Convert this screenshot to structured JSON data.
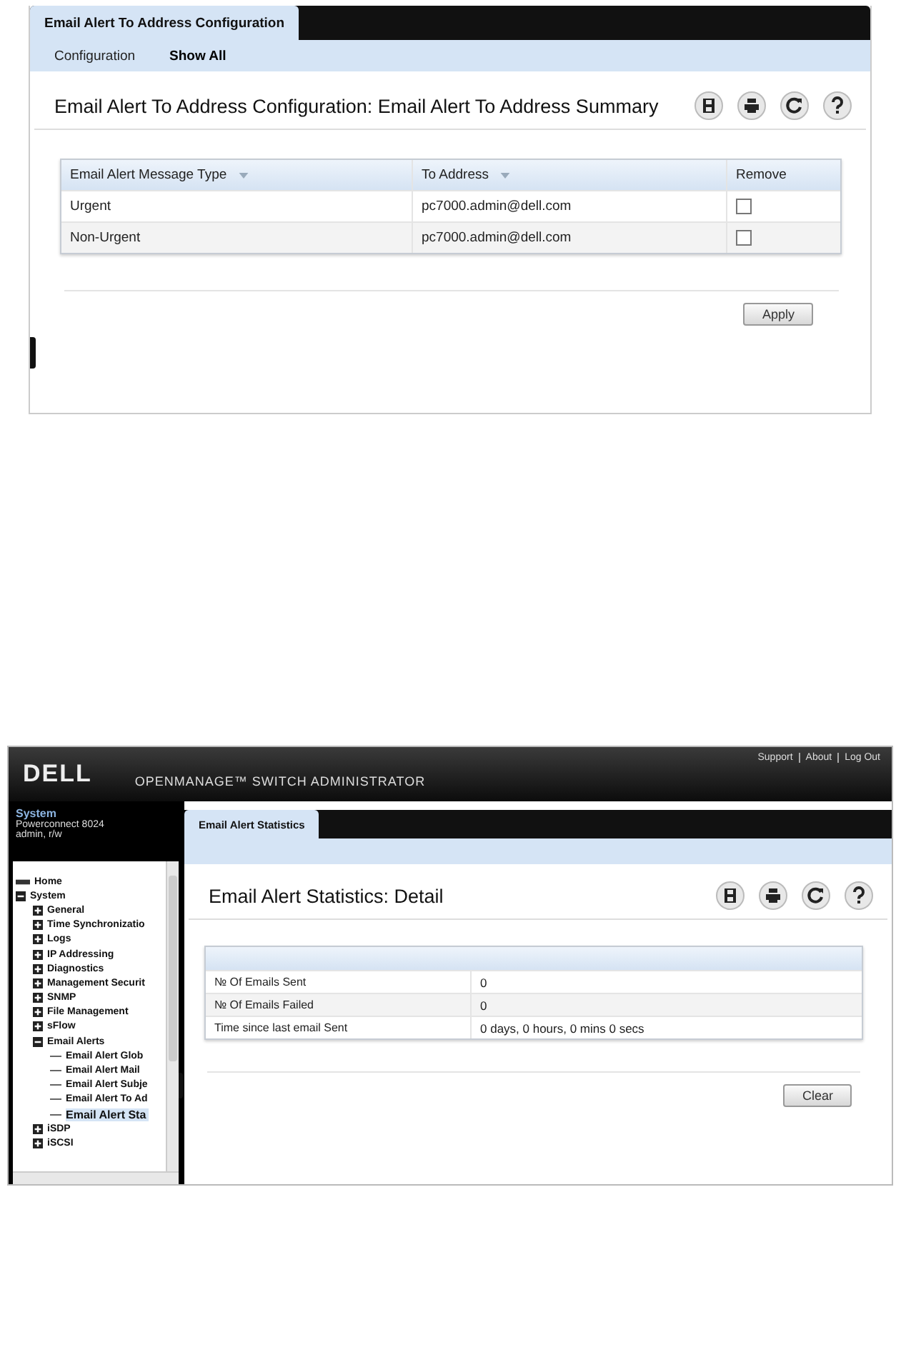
{
  "config_screen": {
    "tabs": [
      {
        "label": "Email Alert To Address Configuration",
        "selected": true
      }
    ],
    "subnav": [
      {
        "label": "Configuration",
        "selected": false
      },
      {
        "label": "Show All",
        "selected": true
      }
    ],
    "heading": "Email Alert To Address Configuration: Email Alert To Address Summary",
    "table": {
      "columns": [
        {
          "label": "Email Alert Message Type",
          "sortable": true
        },
        {
          "label": "To Address",
          "sortable": true
        },
        {
          "label": "Remove",
          "sortable": false
        }
      ],
      "rows": [
        {
          "message_type": "Urgent",
          "to_address": "pc7000.admin@dell.com",
          "remove": false
        },
        {
          "message_type": "Non-Urgent",
          "to_address": "pc7000.admin@dell.com",
          "remove": false
        }
      ]
    },
    "buttons": [
      "Apply"
    ]
  },
  "stats_screen": {
    "header": {
      "logo": "DELL",
      "product": "OPENMANAGE™ SWITCH ADMINISTRATOR",
      "links": [
        "Support",
        "About",
        "Log Out"
      ]
    },
    "device": {
      "title": "System",
      "model": "Powerconnect 8024",
      "user": "admin, r/w"
    },
    "tree": [
      {
        "label": "Home",
        "kind": "home",
        "selected": false
      },
      {
        "label": "System",
        "kind": "folder",
        "expanded": true,
        "selected": false,
        "children": [
          {
            "label": "General",
            "kind": "folder",
            "expanded": false,
            "selected": false
          },
          {
            "label": "Time Synchronizatio",
            "kind": "folder",
            "expanded": false,
            "selected": false
          },
          {
            "label": "Logs",
            "kind": "folder",
            "expanded": false,
            "selected": false
          },
          {
            "label": "IP Addressing",
            "kind": "folder",
            "expanded": false,
            "selected": false
          },
          {
            "label": "Diagnostics",
            "kind": "folder",
            "expanded": false,
            "selected": false
          },
          {
            "label": "Management Securit",
            "kind": "folder",
            "expanded": false,
            "selected": false
          },
          {
            "label": "SNMP",
            "kind": "folder",
            "expanded": false,
            "selected": false
          },
          {
            "label": "File Management",
            "kind": "folder",
            "expanded": false,
            "selected": false
          },
          {
            "label": "sFlow",
            "kind": "folder",
            "expanded": false,
            "selected": false
          },
          {
            "label": "Email Alerts",
            "kind": "folder",
            "expanded": true,
            "selected": false,
            "children": [
              {
                "label": "Email Alert Glob",
                "kind": "leaf",
                "selected": false
              },
              {
                "label": "Email Alert Mail",
                "kind": "leaf",
                "selected": false
              },
              {
                "label": "Email Alert Subje",
                "kind": "leaf",
                "selected": false
              },
              {
                "label": "Email Alert To Ad",
                "kind": "leaf",
                "selected": false
              },
              {
                "label": "Email Alert Sta",
                "kind": "leaf",
                "selected": true
              }
            ]
          },
          {
            "label": "iSDP",
            "kind": "folder",
            "expanded": false,
            "selected": false
          },
          {
            "label": "iSCSI",
            "kind": "folder",
            "expanded": false,
            "selected": false
          }
        ]
      }
    ],
    "tabs": [
      {
        "label": "Email Alert Statistics",
        "selected": true
      }
    ],
    "heading": "Email Alert Statistics: Detail",
    "table": {
      "rows": [
        {
          "label": "№ Of Emails Sent",
          "value": "0"
        },
        {
          "label": "№ Of Emails Failed",
          "value": "0"
        },
        {
          "label": "Time since last email Sent",
          "value": "0 days, 0 hours, 0 mins 0 secs"
        }
      ]
    },
    "buttons": [
      "Clear"
    ]
  }
}
